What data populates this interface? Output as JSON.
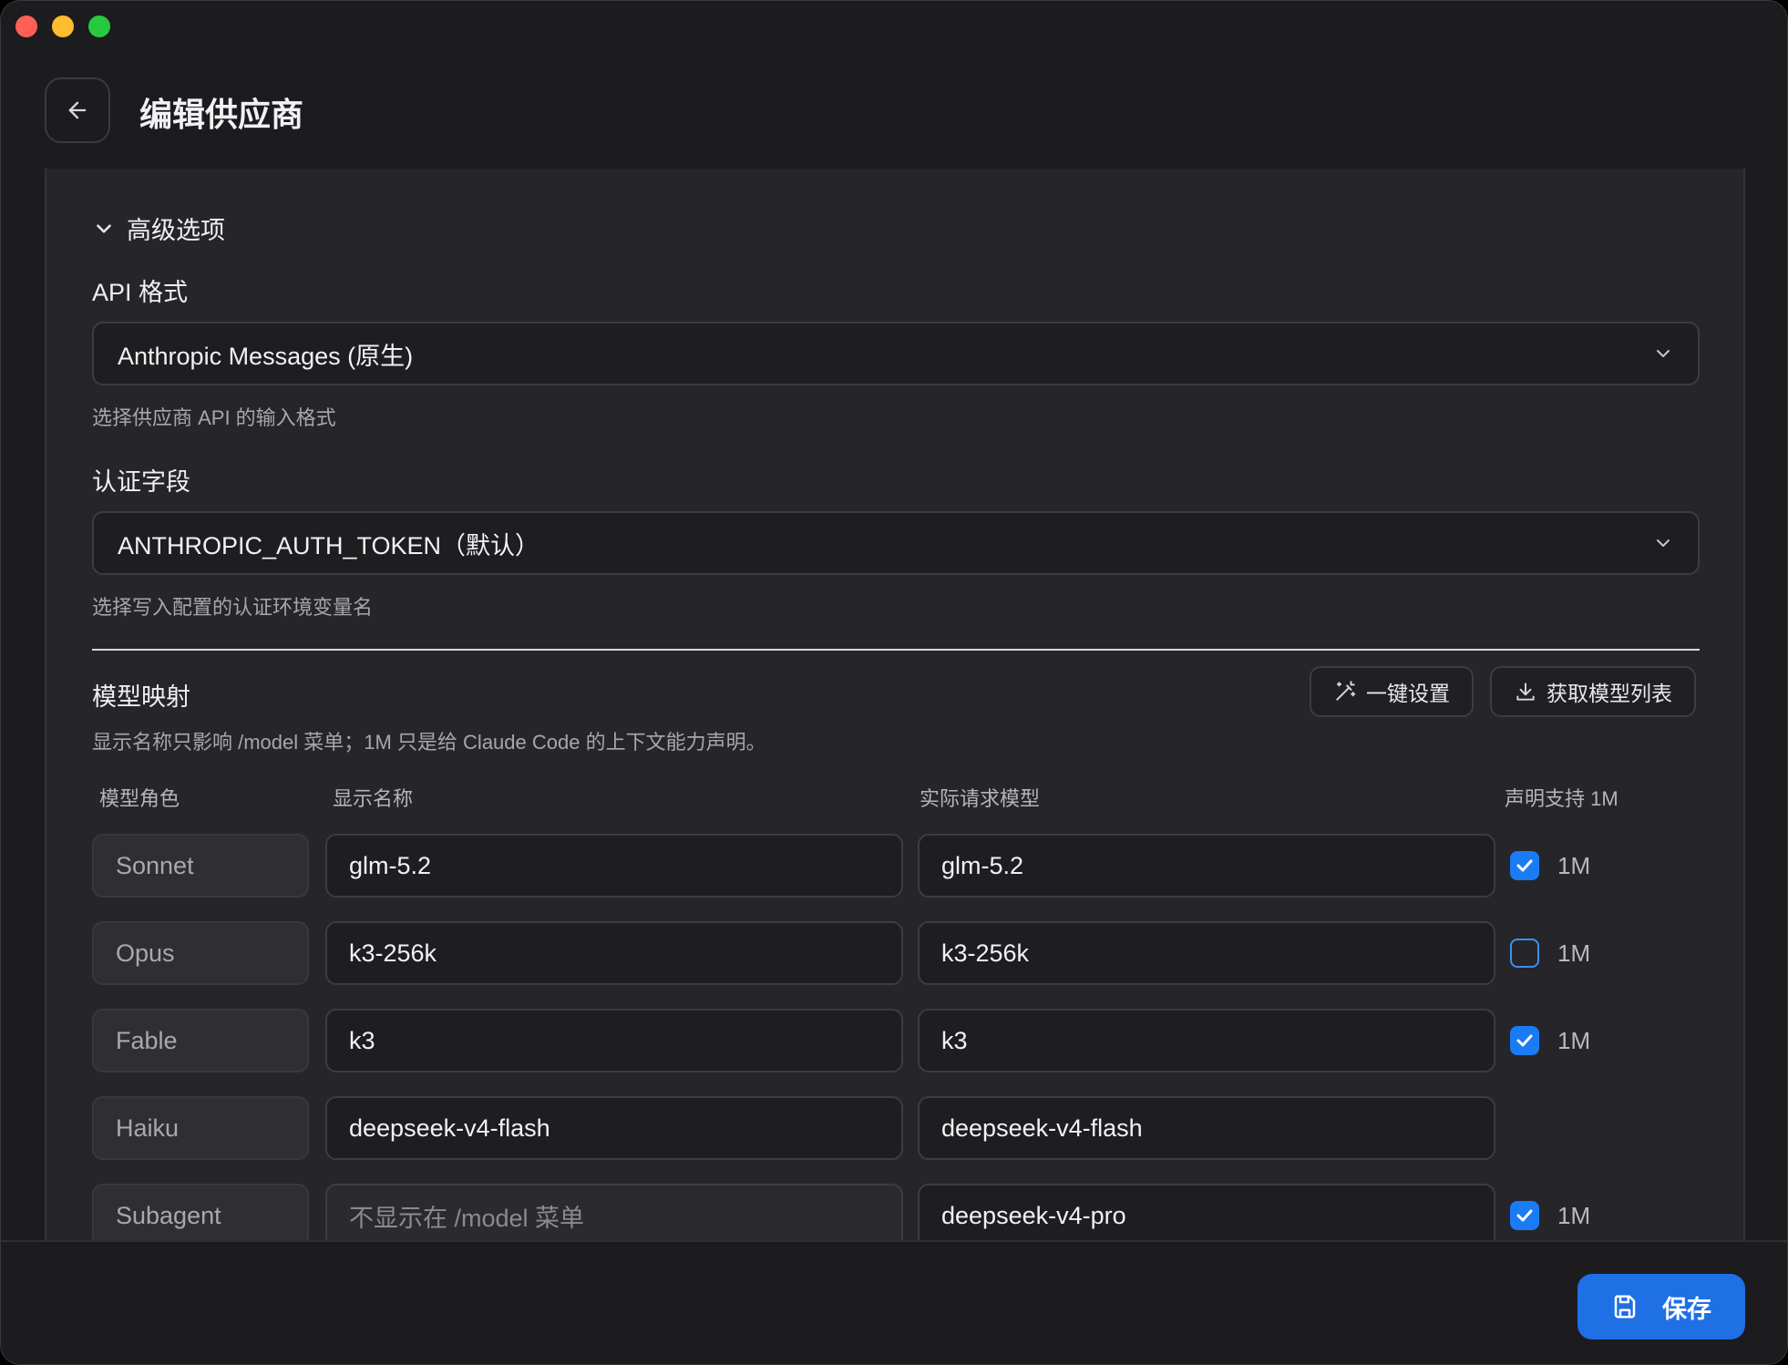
{
  "window": {
    "title": "编辑供应商"
  },
  "advanced": {
    "section_label": "高级选项",
    "api_format": {
      "label": "API 格式",
      "value": "Anthropic Messages (原生)",
      "hint": "选择供应商 API 的输入格式"
    },
    "auth_field": {
      "label": "认证字段",
      "value": "ANTHROPIC_AUTH_TOKEN（默认）",
      "hint": "选择写入配置的认证环境变量名"
    }
  },
  "mapping": {
    "title": "模型映射",
    "hint": "显示名称只影响 /model 菜单；1M 只是给 Claude Code 的上下文能力声明。",
    "quick_setup_label": "一键设置",
    "fetch_models_label": "获取模型列表",
    "columns": {
      "role": "模型角色",
      "display": "显示名称",
      "actual": "实际请求模型",
      "declare": "声明支持 1M"
    },
    "rows": [
      {
        "role": "Sonnet",
        "display": "glm-5.2",
        "actual": "glm-5.2",
        "checked": true,
        "check_label": "1M"
      },
      {
        "role": "Opus",
        "display": "k3-256k",
        "actual": "k3-256k",
        "checked": false,
        "check_label": "1M"
      },
      {
        "role": "Fable",
        "display": "k3",
        "actual": "k3",
        "checked": true,
        "check_label": "1M"
      },
      {
        "role": "Haiku",
        "display": "deepseek-v4-flash",
        "actual": "deepseek-v4-flash",
        "checked": null,
        "check_label": ""
      },
      {
        "role": "Subagent",
        "display": "",
        "display_placeholder": "不显示在 /model 菜单",
        "actual": "deepseek-v4-pro",
        "checked": true,
        "check_label": "1M"
      }
    ]
  },
  "footer": {
    "save_label": "保存"
  },
  "colors": {
    "accent": "#1f6fe5",
    "checkbox": "#1a7cf5",
    "background": "#1c1c1f",
    "panel": "#26262a"
  }
}
